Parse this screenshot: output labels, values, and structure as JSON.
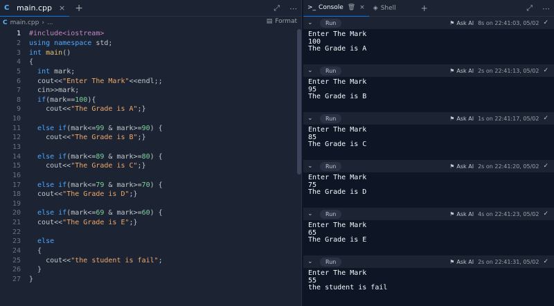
{
  "editor": {
    "tab_label": "main.cpp",
    "tab_icon": "C",
    "tab_close": "×",
    "new_tab": "+",
    "breadcrumb_file": "main.cpp",
    "breadcrumb_sep": "›",
    "breadcrumb_more": "...",
    "format_label": "Format",
    "lines": [
      {
        "n": "1",
        "active": true,
        "html": "<span class=\"pp\">#include&lt;iostream&gt;</span>"
      },
      {
        "n": "2",
        "html": "<span class=\"kw\">using namespace</span> std;"
      },
      {
        "n": "3",
        "html": "<span class=\"ty\">int</span> <span class=\"fn\">main</span>()"
      },
      {
        "n": "4",
        "html": "{"
      },
      {
        "n": "5",
        "html": "  <span class=\"ty\">int</span> mark;"
      },
      {
        "n": "6",
        "html": "  cout&lt;&lt;<span class=\"str\">\"Enter The Mark\"</span>&lt;&lt;endl;;"
      },
      {
        "n": "7",
        "html": "  cin&gt;&gt;mark;"
      },
      {
        "n": "8",
        "html": "  <span class=\"kw\">if</span>(mark==<span class=\"num\">100</span>){"
      },
      {
        "n": "9",
        "html": "    cout&lt;&lt;<span class=\"str\">\"The Grade is A\"</span>;}"
      },
      {
        "n": "10",
        "html": ""
      },
      {
        "n": "11",
        "html": "  <span class=\"kw\">else if</span>(mark&lt;=<span class=\"num\">99</span> &amp; mark&gt;=<span class=\"num\">90</span>) {"
      },
      {
        "n": "12",
        "html": "    cout&lt;&lt;<span class=\"str\">\"The Grade is B\"</span>;}"
      },
      {
        "n": "13",
        "html": ""
      },
      {
        "n": "14",
        "html": "  <span class=\"kw\">else if</span>(mark&lt;=<span class=\"num\">89</span> &amp; mark&gt;=<span class=\"num\">80</span>) {"
      },
      {
        "n": "15",
        "html": "    cout&lt;&lt;<span class=\"str\">\"The Grade is C\"</span>;}"
      },
      {
        "n": "16",
        "html": ""
      },
      {
        "n": "17",
        "html": "  <span class=\"kw\">else if</span>(mark&lt;=<span class=\"num\">79</span> &amp; mark&gt;=<span class=\"num\">70</span>) {"
      },
      {
        "n": "18",
        "html": "  cout&lt;&lt;<span class=\"str\">\"The Grade is D\"</span>;}"
      },
      {
        "n": "19",
        "html": ""
      },
      {
        "n": "20",
        "html": "  <span class=\"kw\">else if</span>(mark&lt;=<span class=\"num\">69</span> &amp; mark&gt;=<span class=\"num\">60</span>) {"
      },
      {
        "n": "21",
        "html": "  cout&lt;&lt;<span class=\"str\">\"The Grade is E\"</span>;}"
      },
      {
        "n": "22",
        "html": ""
      },
      {
        "n": "23",
        "html": "  <span class=\"kw\">else</span>"
      },
      {
        "n": "24",
        "html": "  {"
      },
      {
        "n": "25",
        "html": "    cout&lt;&lt;<span class=\"str\">\"the student is fail\"</span>;"
      },
      {
        "n": "26",
        "html": "  }"
      },
      {
        "n": "27",
        "html": "}"
      }
    ]
  },
  "console": {
    "tabs": [
      {
        "label": "Console",
        "icon": ">_",
        "active": true
      },
      {
        "label": "Shell",
        "icon": "◈",
        "active": false
      }
    ],
    "new_tab": "+",
    "run_label": "Run",
    "ask_ai_label": "Ask AI",
    "runs": [
      {
        "time": "8s on 22:41:03, 05/02",
        "output": "Enter The Mark\n100\nThe Grade is A"
      },
      {
        "time": "2s on 22:41:13, 05/02",
        "output": "Enter The Mark\n95\nThe Grade is B"
      },
      {
        "time": "1s on 22:41:17, 05/02",
        "output": "Enter The Mark\n85\nThe Grade is C"
      },
      {
        "time": "2s on 22:41:20, 05/02",
        "output": "Enter The Mark\n75\nThe Grade is D"
      },
      {
        "time": "4s on 22:41:23, 05/02",
        "output": "Enter The Mark\n65\nThe Grade is E"
      },
      {
        "time": "2s on 22:41:31, 05/02",
        "output": "Enter The Mark\n55\nthe student is fail"
      }
    ]
  }
}
